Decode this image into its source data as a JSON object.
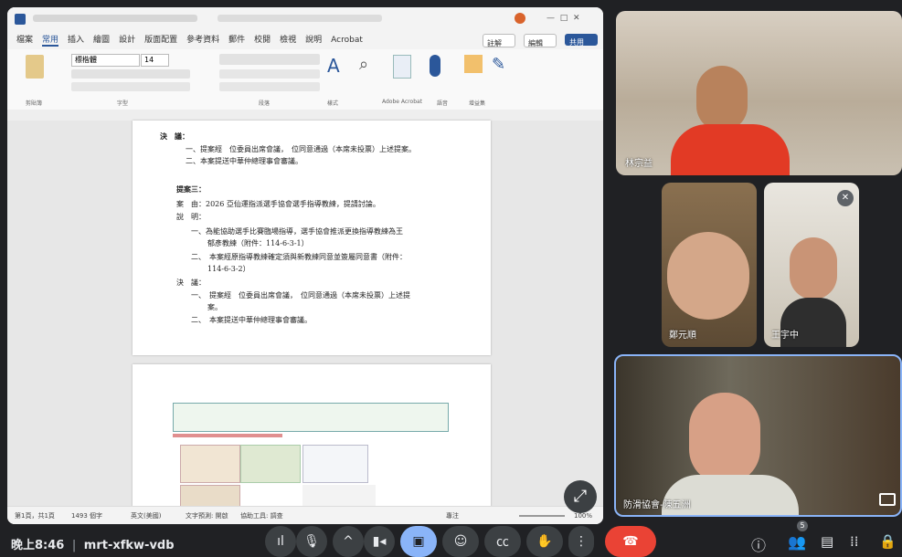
{
  "word": {
    "title": "Word document",
    "menu": [
      "檔案",
      "常用",
      "插入",
      "繪圖",
      "設計",
      "版面配置",
      "參考資料",
      "郵件",
      "校閱",
      "檢視",
      "說明",
      "Acrobat"
    ],
    "comment_btn": "註解",
    "edit_btn": "編輯",
    "share_btn": "共用",
    "ribbon_groups": [
      "剪貼簿",
      "字型",
      "段落",
      "樣式",
      "Adobe Acrobat",
      "語音",
      "增益集"
    ],
    "font_name": "標楷體",
    "font_size": "14",
    "doc": {
      "resolution1": "決　議：",
      "res1_item1": "一、提案經　位委員出席會議，　位同意通過（本席未投票）上述提案。",
      "res1_item2": "二、本案提送中華仲總理事會審議。",
      "proposal_title": "提案三：",
      "subject": "案　由：2026 亞仙運指派選手協會選手指導教練，提請討論。",
      "explanation": "說　明：",
      "exp1": "一、為能協助選手比賽臨場指導，選手協會推派更換指導教練為王",
      "exp1b": "郁彥教練（附件：114-6-3-1）",
      "exp2": "二、　本案經原指導教練確定須與新教練同意並簽屬同意書（附件：",
      "exp2b": "114-6-3-2）",
      "resolution2": "決　議：",
      "res2_item1": "一、　提案經　位委員出席會議，　位同意通過（本席未投票）上述提",
      "res2_item1b": "案。",
      "res2_item2": "二、　本案提送中華仲總理事會審議。"
    },
    "status": {
      "page": "第1頁，共1頁",
      "words": "1493 個字",
      "lang": "英文(美國)",
      "predict": "文字預測: 開啟",
      "access": "協助工具: 調查",
      "focus": "專注",
      "zoom": "100%"
    }
  },
  "participants": [
    {
      "name": "林宗益"
    },
    {
      "name": "鄭元順"
    },
    {
      "name": "王宇中"
    },
    {
      "name": "防滑協會-陳五洲"
    }
  ],
  "meeting": {
    "time": "晚上8:46",
    "separator": "|",
    "code": "mrt-xfkw-vdb",
    "people_count": "5"
  },
  "colors": {
    "accent": "#8ab4f8",
    "end_call": "#ea4335",
    "background": "#202124"
  },
  "icons": [
    "audio-level-icon",
    "microphone-icon",
    "chevron-up-icon",
    "camera-icon",
    "present-icon",
    "emoji-icon",
    "captions-icon",
    "raise-hand-icon",
    "more-icon",
    "end-call-icon",
    "info-icon",
    "people-icon",
    "chat-icon",
    "activities-icon",
    "host-controls-icon",
    "expand-icon",
    "pip-icon"
  ]
}
